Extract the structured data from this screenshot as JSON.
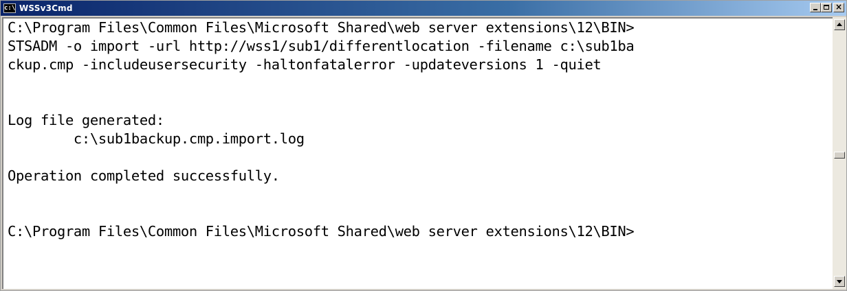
{
  "window": {
    "title": "WSSv3Cmd",
    "icon": "console-icon",
    "icon_text": "c:\\"
  },
  "console": {
    "lines": [
      "C:\\Program Files\\Common Files\\Microsoft Shared\\web server extensions\\12\\BIN>",
      "STSADM -o import -url http://wss1/sub1/differentlocation -filename c:\\sub1ba",
      "ckup.cmp -includeusersecurity -haltonfatalerror -updateversions 1 -quiet",
      "",
      "",
      "Log file generated:",
      "        c:\\sub1backup.cmp.import.log",
      "",
      "Operation completed successfully.",
      "",
      "",
      "C:\\Program Files\\Common Files\\Microsoft Shared\\web server extensions\\12\\BIN>"
    ]
  },
  "colors": {
    "titlebar_start": "#0a246a",
    "titlebar_end": "#a6caf0",
    "console_bg": "#ffffff",
    "console_text": "#000000"
  }
}
